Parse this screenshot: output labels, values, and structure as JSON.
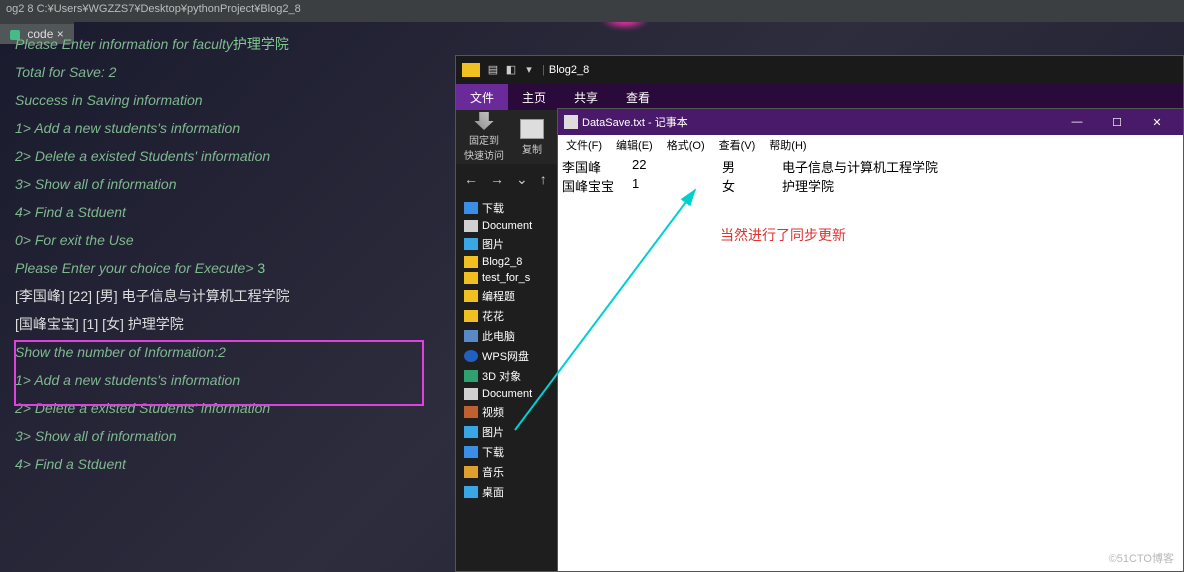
{
  "ide": {
    "titlebar": "og2 8  C:¥Users¥WGZZS7¥Desktop¥pythonProject¥Blog2_8",
    "tab": "code",
    "console_lines": [
      {
        "text": "Please Enter information for faculty",
        "suffix": "护理学院"
      },
      {
        "text": "Total for Save: 2"
      },
      {
        "text": "Success in Saving information"
      },
      {
        "text": "1> Add a new students's information"
      },
      {
        "text": "2> Delete a existed Students' information"
      },
      {
        "text": "3> Show all of information"
      },
      {
        "text": "4> Find a Stduent"
      },
      {
        "text": "0> For exit the Use"
      },
      {
        "text": "Please Enter your choice for Execute>",
        "suffix": " 3"
      },
      {
        "cn": "[李国峰]   [22]   [男]    电子信息与计算机工程学院"
      },
      {
        "cn": "[国峰宝宝]    [1]    [女]   护理学院"
      },
      {
        "text": "Show the number of Information:2"
      },
      {
        "text": "1> Add a new students's information"
      },
      {
        "text": "2> Delete a existed Students' information"
      },
      {
        "text": "3> Show all of information"
      },
      {
        "text": "4> Find a Stduent"
      }
    ]
  },
  "explorer": {
    "title": "Blog2_8",
    "tabs": {
      "file": "文件",
      "home": "主页",
      "share": "共享",
      "view": "查看"
    },
    "ribbon": {
      "pin": "固定到",
      "pin2": "快速访问",
      "copy": "复制"
    },
    "nav": {
      "back": "←",
      "fwd": "→",
      "up": "↑"
    },
    "tree": [
      {
        "label": "下载",
        "ic": "dl"
      },
      {
        "label": "Document",
        "ic": "doc"
      },
      {
        "label": "图片",
        "ic": "pic"
      },
      {
        "label": "Blog2_8",
        "ic": "fold"
      },
      {
        "label": "test_for_s",
        "ic": "fold"
      },
      {
        "label": "编程题",
        "ic": "fold"
      },
      {
        "label": "花花",
        "ic": "fold"
      },
      {
        "label": "此电脑",
        "ic": "pc"
      },
      {
        "label": "WPS网盘",
        "ic": "wps"
      },
      {
        "label": "3D 对象",
        "ic": "d3"
      },
      {
        "label": "Document",
        "ic": "doc"
      },
      {
        "label": "视频",
        "ic": "vid"
      },
      {
        "label": "图片",
        "ic": "pic"
      },
      {
        "label": "下载",
        "ic": "dl"
      },
      {
        "label": "音乐",
        "ic": "music"
      },
      {
        "label": "桌面",
        "ic": "pic"
      }
    ]
  },
  "notepad": {
    "title": "DataSave.txt - 记事本",
    "menus": {
      "file": "文件(F)",
      "edit": "编辑(E)",
      "format": "格式(O)",
      "view": "查看(V)",
      "help": "帮助(H)"
    },
    "rows": [
      {
        "name": "李国峰",
        "age": "22",
        "sex": "男",
        "dept": "电子信息与计算机工程学院"
      },
      {
        "name": "国峰宝宝",
        "age": "1",
        "sex": "女",
        "dept": "护理学院"
      }
    ],
    "winbtns": {
      "min": "—",
      "close": "✕"
    }
  },
  "annotation": "当然进行了同步更新",
  "watermark": "©51CTO博客"
}
